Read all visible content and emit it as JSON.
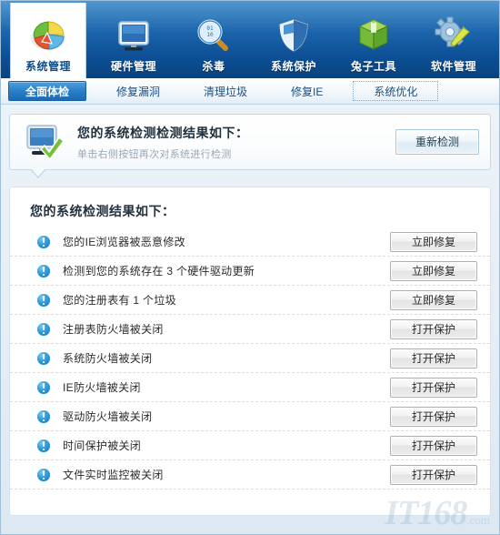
{
  "toolbar": {
    "items": [
      {
        "label": "系统管理",
        "icon": "pie-chart-icon",
        "active": true
      },
      {
        "label": "硬件管理",
        "icon": "monitor-icon",
        "active": false
      },
      {
        "label": "杀毒",
        "icon": "magnifier-icon",
        "active": false
      },
      {
        "label": "系统保护",
        "icon": "shield-icon",
        "active": false
      },
      {
        "label": "兔子工具",
        "icon": "green-box-icon",
        "active": false
      },
      {
        "label": "软件管理",
        "icon": "gear-wrench-icon",
        "active": false
      }
    ]
  },
  "tabs": [
    {
      "label": "全面体检",
      "state": "active"
    },
    {
      "label": "修复漏洞",
      "state": "normal"
    },
    {
      "label": "清理垃圾",
      "state": "normal"
    },
    {
      "label": "修复IE",
      "state": "normal"
    },
    {
      "label": "系统优化",
      "state": "focused"
    }
  ],
  "info_panel": {
    "icon": "monitor-check-icon",
    "title": "您的系统检测检测结果如下：",
    "subtitle": "单击右侧按钮再次对系统进行检测",
    "rescan_label": "重新检测"
  },
  "results": {
    "title": "您的系统检测结果如下：",
    "rows": [
      {
        "icon": "warning-icon",
        "label": "您的IE浏览器被恶意修改",
        "action": "立即修复"
      },
      {
        "icon": "warning-icon",
        "label": "检测到您的系统存在 3 个硬件驱动更新",
        "action": "立即修复"
      },
      {
        "icon": "warning-icon",
        "label": "您的注册表有 1 个垃圾",
        "action": "立即修复"
      },
      {
        "icon": "warning-icon",
        "label": "注册表防火墙被关闭",
        "action": "打开保护"
      },
      {
        "icon": "warning-icon",
        "label": "系统防火墙被关闭",
        "action": "打开保护"
      },
      {
        "icon": "warning-icon",
        "label": "IE防火墙被关闭",
        "action": "打开保护"
      },
      {
        "icon": "warning-icon",
        "label": "驱动防火墙被关闭",
        "action": "打开保护"
      },
      {
        "icon": "warning-icon",
        "label": "时间保护被关闭",
        "action": "打开保护"
      },
      {
        "icon": "warning-icon",
        "label": "文件实时监控被关闭",
        "action": "打开保护"
      }
    ]
  },
  "watermark": {
    "text": "IT168",
    "suffix": ".com"
  },
  "colors": {
    "toolbar_blue": "#1d66ac",
    "active_tab_blue": "#2a7fc8",
    "warning_blue": "#2e9fe0",
    "panel_white": "#ffffff",
    "page_bg": "#e6eef6"
  }
}
